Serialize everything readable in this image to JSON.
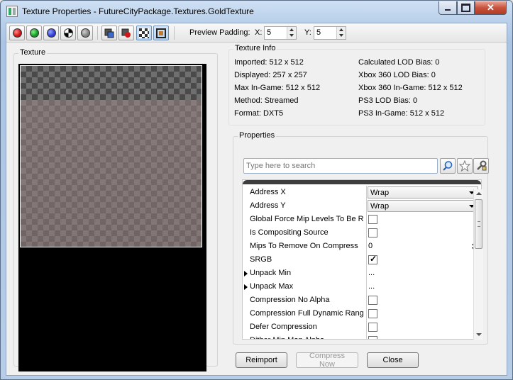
{
  "window": {
    "title": "Texture Properties - FutureCityPackage.Textures.GoldTexture"
  },
  "toolbar": {
    "buttons": [
      {
        "icon": "red-channel-icon",
        "color": "#d01010"
      },
      {
        "icon": "green-channel-icon",
        "color": "#0d9a1e"
      },
      {
        "icon": "blue-channel-icon",
        "color": "#2a3ad8"
      },
      {
        "icon": "alpha-channel-icon",
        "color": "#000000"
      },
      {
        "icon": "desaturate-icon",
        "color": "#808080"
      },
      {
        "icon": "view-mip-icon"
      },
      {
        "icon": "view-alpha-icon"
      },
      {
        "icon": "checkerboard-icon",
        "active": true
      },
      {
        "icon": "border-icon",
        "active": true
      }
    ],
    "preview_padding_label": "Preview Padding:",
    "x_label": "X:",
    "x_value": "5",
    "y_label": "Y:",
    "y_value": "5"
  },
  "texture_panel": {
    "label": "Texture"
  },
  "texture_info": {
    "label": "Texture Info",
    "left": [
      "Imported: 512 x 512",
      "Displayed: 257 x 257",
      "Max In-Game: 512 x 512",
      "Method: Streamed",
      "Format: DXT5"
    ],
    "right": [
      "Calculated LOD Bias: 0",
      "Xbox 360 LOD Bias: 0",
      "Xbox 360 In-Game: 512 x 512",
      "PS3 LOD Bias: 0",
      "PS3 In-Game: 512 x 512"
    ]
  },
  "properties": {
    "label": "Properties",
    "search_placeholder": "Type here to search",
    "rows": [
      {
        "name": "Address X",
        "kind": "combo",
        "value": "Wrap"
      },
      {
        "name": "Address Y",
        "kind": "combo",
        "value": "Wrap"
      },
      {
        "name": "Global Force Mip Levels To Be Resident",
        "kind": "check",
        "checked": false
      },
      {
        "name": "Is Compositing Source",
        "kind": "check",
        "checked": false
      },
      {
        "name": "Mips To Remove On Compress",
        "kind": "number",
        "value": "0"
      },
      {
        "name": "SRGB",
        "kind": "check",
        "checked": true
      },
      {
        "name": "Unpack Min",
        "kind": "expand",
        "value": "..."
      },
      {
        "name": "Unpack Max",
        "kind": "expand",
        "value": "..."
      },
      {
        "name": "Compression No Alpha",
        "kind": "check",
        "checked": false
      },
      {
        "name": "Compression Full Dynamic Range",
        "kind": "check",
        "checked": false
      },
      {
        "name": "Defer Compression",
        "kind": "check",
        "checked": false
      },
      {
        "name": "Dither Mip Map Alpha",
        "kind": "check",
        "checked": false
      }
    ]
  },
  "buttons": {
    "reimport": "Reimport",
    "compress_now": "Compress Now",
    "close": "Close"
  }
}
